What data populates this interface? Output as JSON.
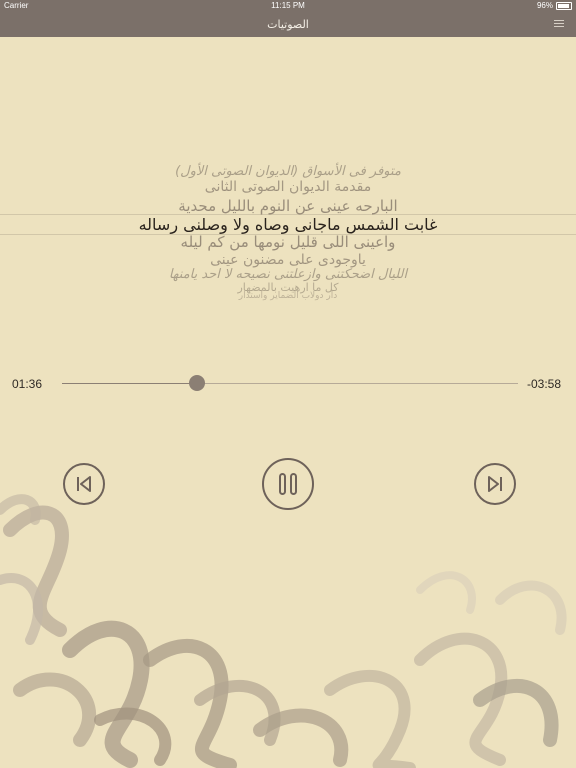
{
  "status_bar": {
    "carrier": "Carrier",
    "time": "11:15 PM",
    "battery": "96%"
  },
  "nav": {
    "title": "الصوتيات",
    "menu_icon": "hamburger-menu-icon"
  },
  "lyrics": {
    "lines": [
      "متوفر فى الأسواق (الديوان الصوتى الأول)",
      "مقدمة الديوان الصوتى الثانى",
      "البارحه عينى عن النوم بالليل محدية",
      "غابت الشمس ماجانى وصاه ولا وصلنى رساله",
      "واعينى اللى قليل نومها من كم ليله",
      "ياوجودى على مضنون عينى",
      "الليال اضحكتنى وازعلتنى نصيحه لا احد يامنها",
      "كل ما ارهيت بالمضهار",
      "دار دولاب الضماير واستدار"
    ],
    "active_index": 3
  },
  "player": {
    "elapsed": "01:36",
    "remaining": "-03:58",
    "progress": 0.295,
    "prev_icon": "skip-previous-icon",
    "pause_icon": "pause-icon",
    "next_icon": "skip-next-icon"
  },
  "colors": {
    "background": "#ede2bf",
    "bar": "#7b7069",
    "accent": "#8b7f74",
    "button_stroke": "#6e625a"
  }
}
